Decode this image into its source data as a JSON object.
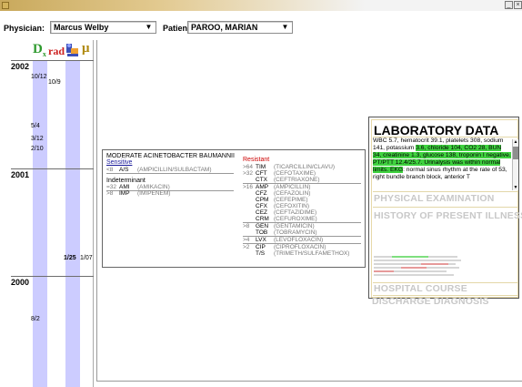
{
  "toolbar": {
    "physician_label": "Physician:",
    "physician_value": "Marcus Welby",
    "patient_label": "Patient:",
    "patient_value": "PAROO, MARIAN"
  },
  "timeline": {
    "header_icons": [
      "Dx",
      "rad",
      "pathology",
      "μ"
    ],
    "header_text": {
      "dx": "D",
      "dx_sub": "x",
      "rad": "rad",
      "micro": "μ"
    },
    "years": [
      "2002",
      "2001",
      "2000"
    ],
    "dates": [
      "10/12",
      "10/9",
      "5/4",
      "3/12",
      "2/10",
      "1/25",
      "1/07",
      "8/2"
    ]
  },
  "micro": {
    "title": "MODERATE ACINETOBACTER BAUMANNII",
    "sensitive_label": "Sensitive",
    "resistant_label": "Resistant",
    "indeterminant_label": "Indeterminant",
    "sensitive": [
      {
        "mic": "<8",
        "abbr": "A/S",
        "name": "(AMPICILLIN/SULBACTAM)"
      }
    ],
    "indeterminant": [
      {
        "mic": "=32",
        "abbr": "AMI",
        "name": "(AMIKACIN)"
      },
      {
        "mic": ">8",
        "abbr": "IMP",
        "name": "(IMIPENEM)"
      }
    ],
    "resistant": [
      {
        "mic": ">64",
        "abbr": "TIM",
        "name": "(TICARCILLIN/CLAVU)"
      },
      {
        "mic": ">32",
        "abbr": "CFT",
        "name": "(CEFOTAXIME)"
      },
      {
        "mic": "",
        "abbr": "CTX",
        "name": "(CEFTRIAXONE)"
      },
      {
        "mic": ">16",
        "abbr": "AMP",
        "name": "(AMPICILLIN)"
      },
      {
        "mic": "",
        "abbr": "CFZ",
        "name": "(CEFAZOLIN)"
      },
      {
        "mic": "",
        "abbr": "CPM",
        "name": "(CEFEPIME)"
      },
      {
        "mic": "",
        "abbr": "CFX",
        "name": "(CEFOXITIN)"
      },
      {
        "mic": "",
        "abbr": "CEZ",
        "name": "(CEFTAZIDIME)"
      },
      {
        "mic": "",
        "abbr": "CRM",
        "name": "(CEFUROXIME)"
      },
      {
        "mic": ">8",
        "abbr": "GEN",
        "name": "(GENTAMICIN)"
      },
      {
        "mic": "",
        "abbr": "TOB",
        "name": "(TOBRAMYCIN)"
      },
      {
        "mic": ">4",
        "abbr": "LVX",
        "name": "(LEVOFLOXACIN)"
      },
      {
        "mic": ">2",
        "abbr": "CIP",
        "name": "(CIPROFLOXACIN)"
      },
      {
        "mic": "",
        "abbr": "T/S",
        "name": "(TRIMETH/SULFAMETHOX)"
      }
    ]
  },
  "lab": {
    "title": "LABORATORY DATA",
    "text_a": "WBC 5.7, hematocrit 39.1, platelets 308, sodium 141, potassium ",
    "text_b": "3.6, chloride 104, CO2 28, BUN 34, creatinine 1.3, glucose 138, troponin I negative. PT/PTT 12.4/25.7. Urinalysis was within normal limits. EKG",
    "text_c": ": normal sinus rhythm at the rate of 53, right bundle branch block, anterior T",
    "sections": [
      "PHYSICAL EXAMINATION",
      "HISTORY OF PRESENT ILLNESS",
      "HOSPITAL COURSE",
      "DISCHARGE DIAGNOSIS"
    ],
    "highlight_color": "#3fd23f"
  },
  "window": {
    "minimize": "_",
    "close": "×"
  }
}
